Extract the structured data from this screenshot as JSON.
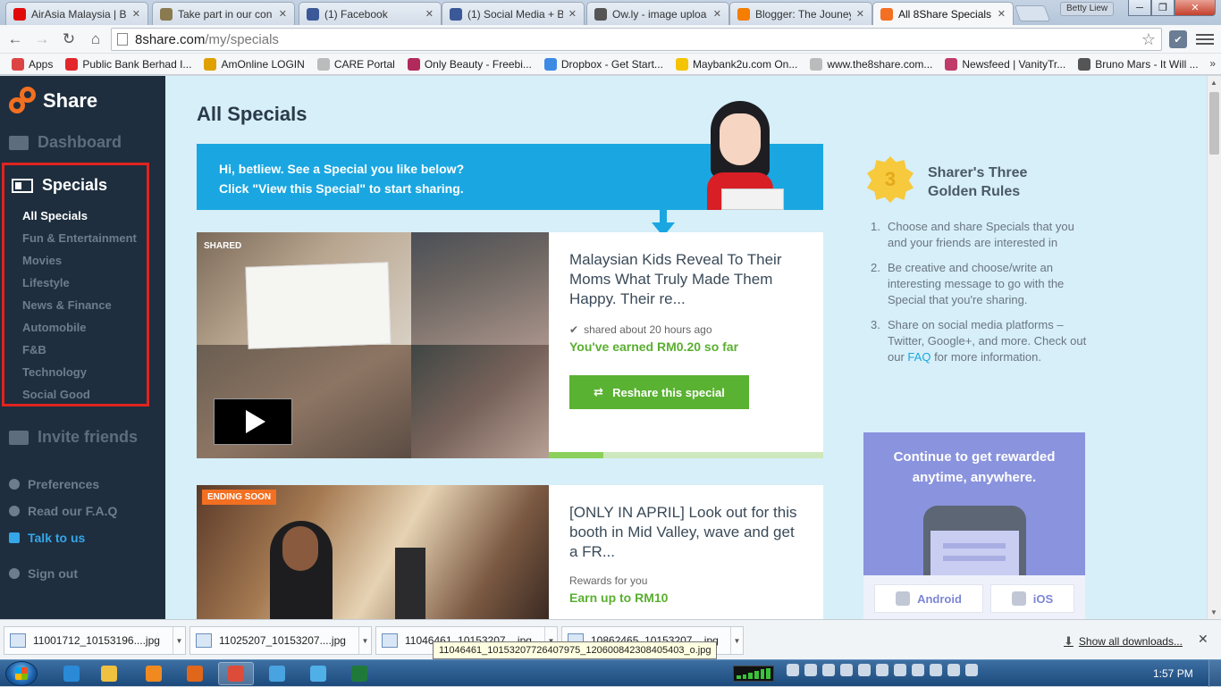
{
  "browser": {
    "tabs": [
      {
        "title": "AirAsia Malaysia | Be",
        "favicon_color": "#e10a0a",
        "active": false
      },
      {
        "title": "Take part in our con",
        "favicon_color": "#8a7a50",
        "active": false
      },
      {
        "title": "(1) Facebook",
        "favicon_color": "#3b5998",
        "active": false
      },
      {
        "title": "(1) Social Media + B",
        "favicon_color": "#3b5998",
        "active": false
      },
      {
        "title": "Ow.ly - image uploa",
        "favicon_color": "#555555",
        "active": false
      },
      {
        "title": "Blogger: The Jouney",
        "favicon_color": "#f57d00",
        "active": false
      },
      {
        "title": "All 8Share Specials",
        "favicon_color": "#f36f21",
        "active": true
      }
    ],
    "user_name": "Betty Liew",
    "window_buttons": {
      "minimize": "─",
      "maximize": "❐",
      "close": "✕"
    },
    "url_host": "8share.com",
    "url_path": "/my/specials",
    "back_icon": "←",
    "forward_icon": "→",
    "reload_icon": "↻",
    "home_icon": "⌂",
    "star_icon": "☆",
    "bookmarks": [
      {
        "label": "Apps",
        "color": "#d44"
      },
      {
        "label": "Public Bank Berhad I...",
        "color": "#e3262b"
      },
      {
        "label": "AmOnline LOGIN",
        "color": "#e0a000"
      },
      {
        "label": "CARE Portal",
        "color": "#bbbbbb"
      },
      {
        "label": "Only Beauty - Freebi...",
        "color": "#b12a5b"
      },
      {
        "label": "Dropbox - Get Start...",
        "color": "#3d8ae5"
      },
      {
        "label": "Maybank2u.com On...",
        "color": "#f5c400"
      },
      {
        "label": "www.the8share.com...",
        "color": "#bbbbbb"
      },
      {
        "label": "Newsfeed | VanityTr...",
        "color": "#c03a6a"
      },
      {
        "label": "Bruno Mars - It Will ...",
        "color": "#555555"
      }
    ],
    "bookmarks_more": "»"
  },
  "sidebar": {
    "logo_text": "Share",
    "dashboard": "Dashboard",
    "specials": "Specials",
    "categories": [
      "All Specials",
      "Fun & Entertainment",
      "Movies",
      "Lifestyle",
      "News & Finance",
      "Automobile",
      "F&B",
      "Technology",
      "Social Good"
    ],
    "invite": "Invite friends",
    "preferences": "Preferences",
    "faq": "Read our F.A.Q",
    "talk": "Talk to us",
    "signout": "Sign out"
  },
  "main": {
    "title": "All Specials",
    "banner_line1": "Hi, betliew. See a Special you like below?",
    "banner_line2": "Click \"View this Special\" to start sharing.",
    "cards": [
      {
        "tag": "SHARED",
        "title": "Malaysian Kids Reveal To Their Moms What Truly Made Them Happy. Their re...",
        "shared_text": "shared about 20 hours ago",
        "earned_text": "You've earned RM0.20 so far",
        "button": "Reshare this special",
        "progress": 0.2
      },
      {
        "tag": "ENDING SOON",
        "title": "[ONLY IN APRIL] Look out for this booth in Mid Valley, wave and get a FR...",
        "rewards_label": "Rewards for you",
        "rewards_value": "Earn up to RM10"
      }
    ]
  },
  "rules": {
    "badge": "3",
    "title": "Sharer's Three Golden Rules",
    "items": [
      {
        "num": "1.",
        "text": "Choose and share Specials that you and your friends are interested in"
      },
      {
        "num": "2.",
        "text": "Be creative and choose/write an interesting message to go with the Special that you're sharing."
      },
      {
        "num": "3.",
        "text_before": "Share on social media platforms – Twitter, Google+, and more. Check out our",
        "link": "FAQ",
        "text_after": "for more information."
      }
    ]
  },
  "reward_panel": {
    "title_line1": "Continue to get rewarded",
    "title_line2": "anytime, anywhere.",
    "android": "Android",
    "ios": "iOS"
  },
  "downloads": {
    "items": [
      "11001712_10153196....jpg",
      "11025207_10153207....jpg",
      "11046461_10153207....jpg",
      "10862465_10153207....jpg"
    ],
    "tooltip": "11046461_10153207726407975_120600842308405403_o.jpg",
    "show_all": "Show all downloads...",
    "close": "✕"
  },
  "taskbar": {
    "apps": [
      {
        "name": "ie",
        "color": "#2a8ad8"
      },
      {
        "name": "explorer",
        "color": "#f0c040"
      },
      {
        "name": "media-player",
        "color": "#f08a20"
      },
      {
        "name": "firefox",
        "color": "#e0661a"
      },
      {
        "name": "chrome",
        "color": "#dd4b39"
      },
      {
        "name": "globe",
        "color": "#48a3e0"
      },
      {
        "name": "messenger",
        "color": "#4fb0e8"
      },
      {
        "name": "excel",
        "color": "#1f7a3a"
      }
    ],
    "clock": "1:57 PM"
  }
}
